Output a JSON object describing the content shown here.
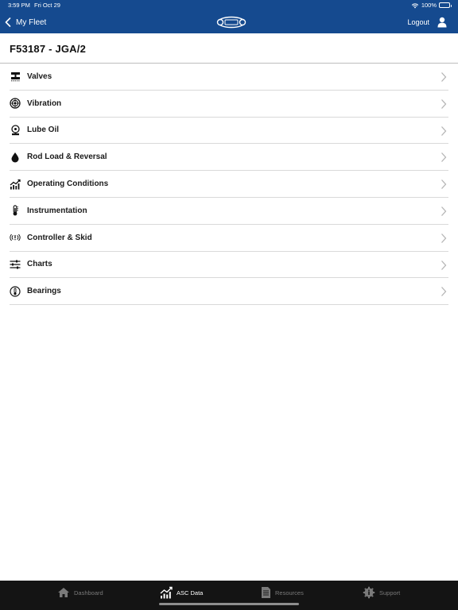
{
  "status_bar": {
    "time": "3:59 PM",
    "date": "Fri Oct 29",
    "battery": "100%"
  },
  "nav": {
    "back_label": "My Fleet",
    "logout_label": "Logout"
  },
  "page": {
    "title": "F53187 - JGA/2"
  },
  "menu": {
    "items": [
      {
        "label": "Valves",
        "icon": "valve-icon"
      },
      {
        "label": "Vibration",
        "icon": "vibration-icon"
      },
      {
        "label": "Lube Oil",
        "icon": "lube-oil-icon"
      },
      {
        "label": "Rod Load & Reversal",
        "icon": "droplet-icon"
      },
      {
        "label": "Operating Conditions",
        "icon": "chart-trend-icon"
      },
      {
        "label": "Instrumentation",
        "icon": "thermometer-icon"
      },
      {
        "label": "Controller & Skid",
        "icon": "alert-signal-icon"
      },
      {
        "label": "Charts",
        "icon": "sliders-icon"
      },
      {
        "label": "Bearings",
        "icon": "bearing-icon"
      }
    ]
  },
  "tabbar": {
    "tabs": [
      {
        "label": "Dashboard",
        "icon": "home-icon",
        "active": false
      },
      {
        "label": "ASC Data",
        "icon": "chart-trend-icon",
        "active": true
      },
      {
        "label": "Resources",
        "icon": "document-icon",
        "active": false
      },
      {
        "label": "Support",
        "icon": "support-gear-icon",
        "active": false
      }
    ]
  },
  "colors": {
    "header_bg": "#154a8f",
    "tabbar_bg": "#141414",
    "active_tab": "#ffffff",
    "inactive_tab": "#7a7a7a"
  }
}
